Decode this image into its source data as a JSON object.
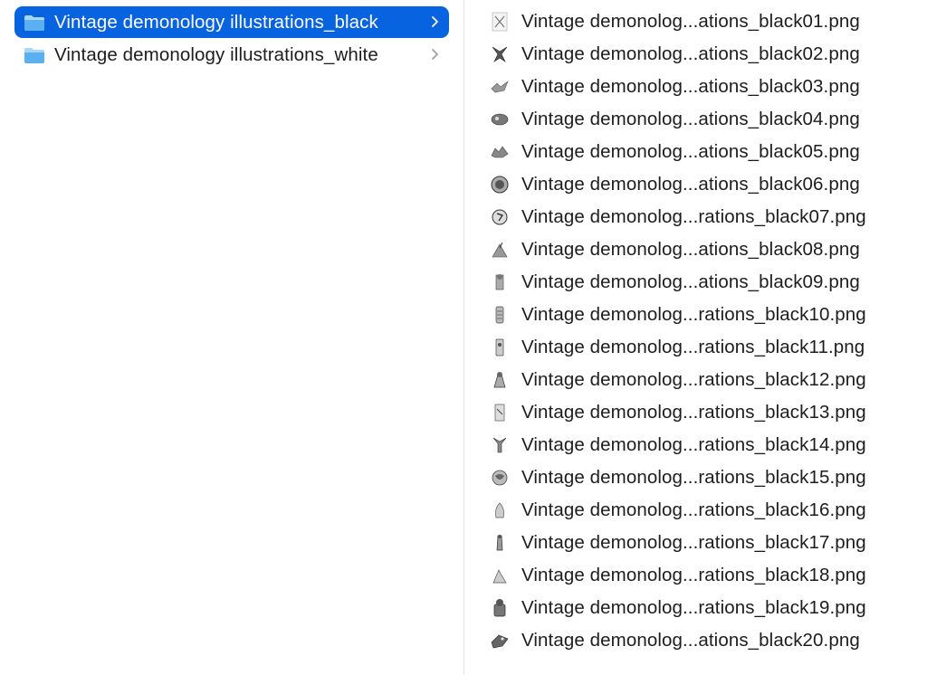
{
  "folders": [
    {
      "label": "Vintage demonology illustrations_black",
      "selected": true
    },
    {
      "label": "Vintage demonology illustrations_white",
      "selected": false
    }
  ],
  "files": [
    {
      "label": "Vintage demonolog...ations_black01.png"
    },
    {
      "label": "Vintage demonolog...ations_black02.png"
    },
    {
      "label": "Vintage demonolog...ations_black03.png"
    },
    {
      "label": "Vintage demonolog...ations_black04.png"
    },
    {
      "label": "Vintage demonolog...ations_black05.png"
    },
    {
      "label": "Vintage demonolog...ations_black06.png"
    },
    {
      "label": "Vintage demonolog...rations_black07.png"
    },
    {
      "label": "Vintage demonolog...ations_black08.png"
    },
    {
      "label": "Vintage demonolog...ations_black09.png"
    },
    {
      "label": "Vintage demonolog...rations_black10.png"
    },
    {
      "label": "Vintage demonolog...rations_black11.png"
    },
    {
      "label": "Vintage demonolog...rations_black12.png"
    },
    {
      "label": "Vintage demonolog...rations_black13.png"
    },
    {
      "label": "Vintage demonolog...rations_black14.png"
    },
    {
      "label": "Vintage demonolog...rations_black15.png"
    },
    {
      "label": "Vintage demonolog...rations_black16.png"
    },
    {
      "label": "Vintage demonolog...rations_black17.png"
    },
    {
      "label": "Vintage demonolog...rations_black18.png"
    },
    {
      "label": "Vintage demonolog...rations_black19.png"
    },
    {
      "label": "Vintage demonolog...ations_black20.png"
    }
  ],
  "colors": {
    "selection": "#0863e0",
    "folder_icon": "#5ab0f0",
    "text": "#1d1d1f",
    "chevron": "#a0a0a5"
  }
}
